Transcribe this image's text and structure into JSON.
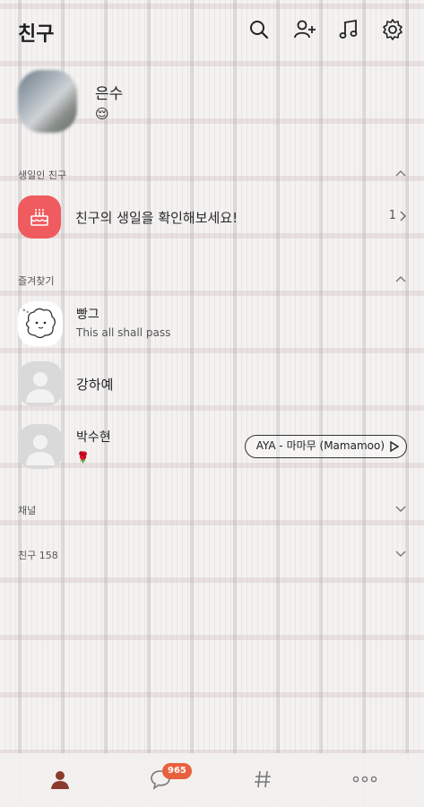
{
  "header": {
    "title": "친구",
    "icons": [
      "search-icon",
      "add-friend-icon",
      "music-icon",
      "settings-icon"
    ]
  },
  "profile": {
    "name": "은수",
    "emoji": "😌"
  },
  "sections": {
    "birthday": "생일인 친구",
    "favorites": "즐겨찾기",
    "channel": "채널",
    "friends": "친구 158"
  },
  "birthday_row": {
    "text": "친구의 생일을 확인해보세요!",
    "count": "1"
  },
  "favorites": [
    {
      "name": "빵그",
      "status": "This all shall pass"
    },
    {
      "name": "강하예",
      "status": ""
    },
    {
      "name": "박수현",
      "status": "🌹",
      "music": "AYA - 마마무 (Mamamoo)"
    }
  ],
  "bottom_nav": {
    "chat_badge": "965",
    "items": [
      "friends-tab",
      "chats-tab",
      "openchat-tab",
      "more-tab"
    ]
  },
  "colors": {
    "accent": "#ef5b5e",
    "badge": "#e8613f",
    "active_tab": "#8b3a2e"
  }
}
